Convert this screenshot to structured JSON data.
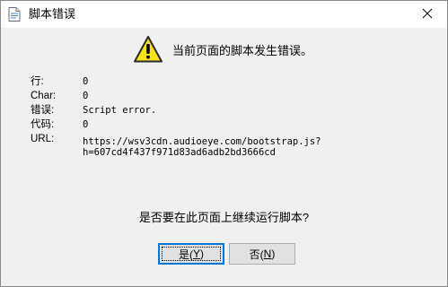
{
  "window": {
    "title": "脚本错误",
    "close_glyph": "✕"
  },
  "message": "当前页面的脚本发生错误。",
  "details": [
    {
      "label": "行:",
      "value": "0"
    },
    {
      "label": "Char:",
      "value": "0"
    },
    {
      "label": "错误:",
      "value": "Script error."
    },
    {
      "label": "代码:",
      "value": "0"
    },
    {
      "label": "URL:",
      "value": "https://wsv3cdn.audioeye.com/bootstrap.js?",
      "value2": "h=607cd4f437f971d83ad6adb2bd3666cd"
    }
  ],
  "question": "是否要在此页面上继续运行脚本?",
  "buttons": {
    "yes": {
      "label": "是(",
      "key": "Y",
      "suffix": ")"
    },
    "no": {
      "label": "否(",
      "key": "N",
      "suffix": ")"
    }
  },
  "colors": {
    "warning_yellow": "#f7e21a",
    "default_button_border": "#0078d7"
  },
  "icons": {
    "title": "script-document-icon",
    "warning": "warning-triangle-icon",
    "close": "close-icon"
  }
}
